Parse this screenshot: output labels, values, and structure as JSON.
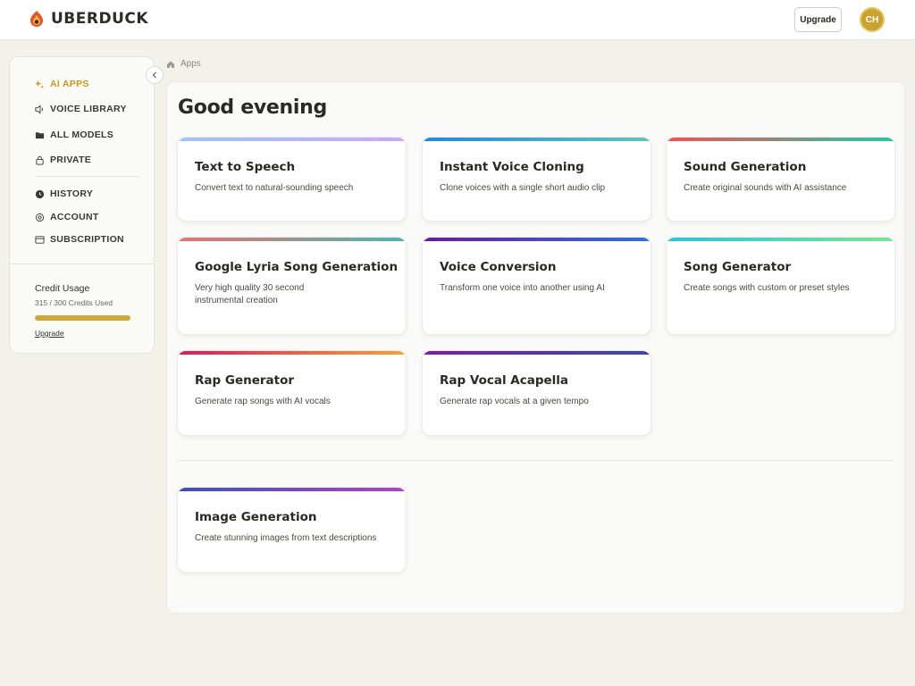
{
  "header": {
    "brand": "UBERDUCK",
    "upgrade_label": "Upgrade",
    "avatar_initials": "CH"
  },
  "sidebar": {
    "items": [
      {
        "label": "AI APPS",
        "icon": "sparkle-icon",
        "active": true
      },
      {
        "label": "VOICE LIBRARY",
        "icon": "speaker-icon"
      },
      {
        "label": "ALL MODELS",
        "icon": "folder-icon"
      },
      {
        "label": "PRIVATE",
        "icon": "lock-icon"
      },
      {
        "label": "HISTORY",
        "icon": "clock-icon"
      },
      {
        "label": "ACCOUNT",
        "icon": "gear-icon"
      },
      {
        "label": "SUBSCRIPTION",
        "icon": "card-icon"
      }
    ],
    "credit": {
      "title": "Credit Usage",
      "used_text": "315 / 300 Credits Used",
      "used_fraction": 1.0,
      "upgrade_link": "Upgrade"
    }
  },
  "breadcrumb": {
    "label": "Apps"
  },
  "main": {
    "greeting": "Good evening",
    "apps": [
      {
        "title": "Text to Speech",
        "description": "Convert text to natural-sounding speech",
        "gradient": [
          "#9ec4f5",
          "#c7a8f5"
        ]
      },
      {
        "title": "Instant Voice Cloning",
        "description": "Clone voices with a single short audio clip",
        "gradient": [
          "#1e88e5",
          "#5ec7b5"
        ]
      },
      {
        "title": "Sound Generation",
        "description": "Create original sounds with AI assistance",
        "gradient": [
          "#ef5350",
          "#26c6a8"
        ]
      },
      {
        "title": "Google Lyria Song Generation",
        "description": "Very high quality 30 second instrumental creation",
        "gradient": [
          "#e57373",
          "#4db6ac"
        ]
      },
      {
        "title": "Voice Conversion",
        "description": "Transform one voice into another using AI",
        "gradient": [
          "#6a1b9a",
          "#2f6fe0"
        ]
      },
      {
        "title": "Song Generator",
        "description": "Create songs with custom or preset styles",
        "gradient": [
          "#26c6da",
          "#7be495"
        ]
      },
      {
        "title": "Rap Generator",
        "description": "Generate rap songs with AI vocals",
        "gradient": [
          "#d81b60",
          "#f6a23a"
        ]
      },
      {
        "title": "Rap Vocal Acapella",
        "description": "Generate rap vocals at a given tempo",
        "gradient": [
          "#7b1fa2",
          "#3949ab"
        ]
      }
    ],
    "extra": [
      {
        "title": "Image Generation",
        "description": "Create stunning images from text descriptions",
        "gradient": [
          "#3f51b5",
          "#ab47bc"
        ]
      }
    ]
  }
}
